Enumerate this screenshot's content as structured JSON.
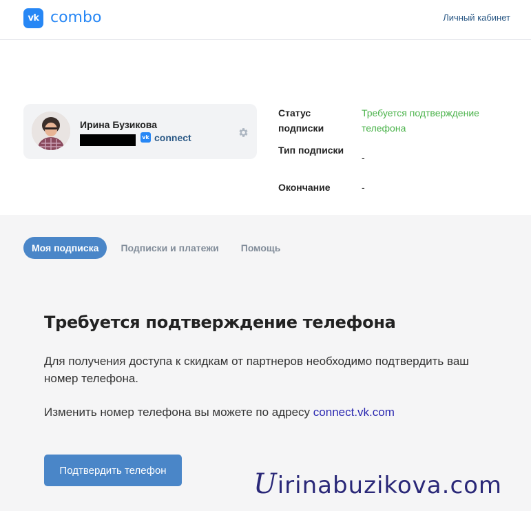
{
  "header": {
    "logo_text": "vk",
    "brand": "combo",
    "cabinet_link": "Личный кабинет"
  },
  "profile": {
    "name": "Ирина Бузикова",
    "badge_text": "vk",
    "connect_label": "connect"
  },
  "subscription_info": {
    "rows": [
      {
        "label": "Статус подписки",
        "value": "Требуется подтверждение телефона"
      },
      {
        "label": "Тип подписки",
        "value": "-"
      },
      {
        "label": "Окончание",
        "value": "-"
      }
    ]
  },
  "tabs": [
    {
      "label": "Моя подписка",
      "active": true
    },
    {
      "label": "Подписки и платежи",
      "active": false
    },
    {
      "label": "Помощь",
      "active": false
    }
  ],
  "main": {
    "title": "Требуется подтверждение телефона",
    "text1": "Для получения доступа к скидкам от партнеров необходимо подтвердить ваш номер телефона.",
    "text2_prefix": "Изменить номер телефона вы можете по адресу",
    "text2_link": "connect.vk.com",
    "button_label": "Подтвердить телефон"
  },
  "watermark": {
    "mark": "U",
    "text": "irinabuzikova.com"
  },
  "colors": {
    "accent": "#2787f5",
    "button": "#4a86c8",
    "status_green": "#4bb34b",
    "link": "#2a5885"
  },
  "icons": {
    "settings": "gear-icon",
    "vk_badge": "vk-logo-icon"
  }
}
